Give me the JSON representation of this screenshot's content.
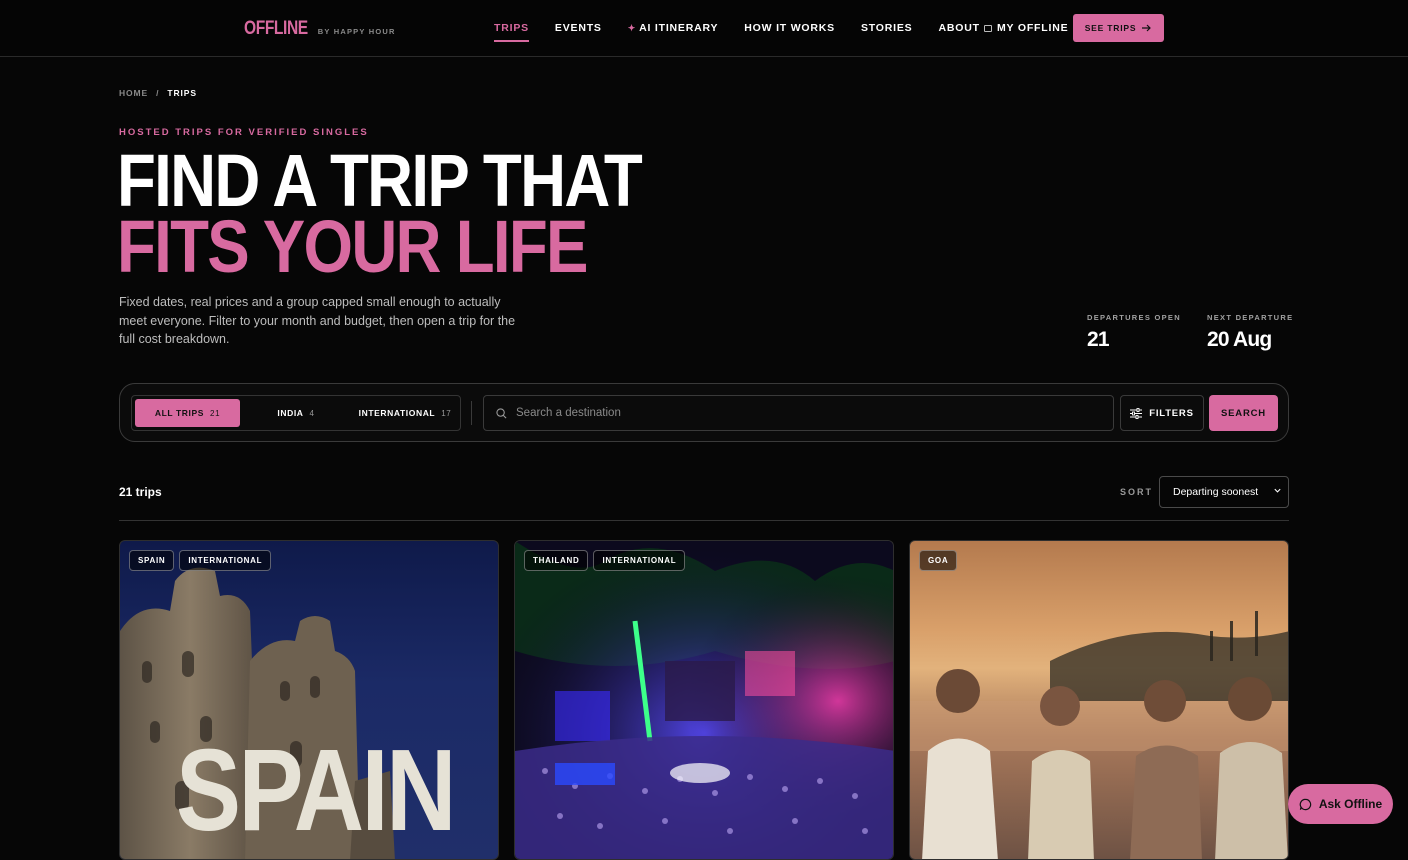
{
  "brand": {
    "name": "OFFLINE",
    "sub": "BY HAPPY HOUR",
    "accent": "#d86aa0"
  },
  "nav": {
    "links": [
      "TRIPS",
      "EVENTS",
      "AI ITINERARY",
      "HOW IT WORKS",
      "STORIES",
      "ABOUT"
    ],
    "active": "TRIPS",
    "my_offline": "MY OFFLINE",
    "cta": "SEE TRIPS"
  },
  "breadcrumb": {
    "home": "HOME",
    "sep": "/",
    "current": "TRIPS"
  },
  "hero": {
    "eyebrow": "HOSTED TRIPS FOR VERIFIED SINGLES",
    "title_line1": "FIND A TRIP THAT",
    "title_line2": "FITS YOUR LIFE",
    "lede": "Fixed dates, real prices and a group capped small enough to actually meet everyone. Filter to your month and budget, then open a trip for the full cost breakdown."
  },
  "stats": [
    {
      "label": "DEPARTURES OPEN",
      "value": "21"
    },
    {
      "label": "NEXT DEPARTURE",
      "value": "20 Aug"
    }
  ],
  "filter": {
    "segments": [
      {
        "label": "ALL TRIPS",
        "count": "21",
        "active": true
      },
      {
        "label": "INDIA",
        "count": "4",
        "active": false
      },
      {
        "label": "INTERNATIONAL",
        "count": "17",
        "active": false
      }
    ],
    "search_placeholder": "Search a destination",
    "filters_label": "FILTERS",
    "search_label": "SEARCH"
  },
  "results": {
    "count_text": "21 trips",
    "sort_label": "SORT",
    "sort_value": "Departing soonest"
  },
  "cards": [
    {
      "tags": [
        "SPAIN",
        "INTERNATIONAL"
      ],
      "overlay_text": "SPAIN"
    },
    {
      "tags": [
        "THAILAND",
        "INTERNATIONAL"
      ]
    },
    {
      "tags": [
        "GOA"
      ]
    }
  ],
  "chat": {
    "label": "Ask Offline"
  }
}
